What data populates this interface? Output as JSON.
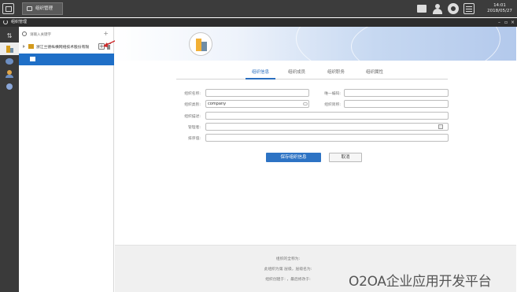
{
  "topbar": {
    "taskbar_item": "组织管理",
    "clock_time": "14:01",
    "clock_date": "2018/05/27"
  },
  "window": {
    "title": "组织管理"
  },
  "tree": {
    "search_placeholder": "请输入关键字",
    "search_add_label": "+",
    "root_org_name": "浙江兰德纵横网络技术股份有限",
    "add_button_label": "+"
  },
  "tabs": [
    {
      "label": "组织信息"
    },
    {
      "label": "组织成员"
    },
    {
      "label": "组织职务"
    },
    {
      "label": "组织属性"
    }
  ],
  "form": {
    "name_label": "组织名称:",
    "name_value": "",
    "unique_code_label": "唯一编码:",
    "unique_code_value": "",
    "type_label": "组织类别:",
    "type_value": "company",
    "short_name_label": "组织简称:",
    "short_name_value": "",
    "description_label": "组织描述:",
    "description_value": "",
    "manager_label": "管理者:",
    "manager_value": "",
    "order_label": "排序值:",
    "order_value": ""
  },
  "actions": {
    "save_label": "保存组织信息",
    "cancel_label": "取消"
  },
  "footer": {
    "line1": "组织的全称为:",
    "line2": "此组织为第 层级，层级名为:",
    "line3": "组织创建于: ，最后修改于:"
  },
  "watermark": "O2OA企业应用开发平台",
  "colors": {
    "accent_blue": "#2d73c4",
    "tree_selected": "#1f6fc7",
    "topbar_bg": "#3c3c3c",
    "arrow_red": "#d0282a"
  }
}
